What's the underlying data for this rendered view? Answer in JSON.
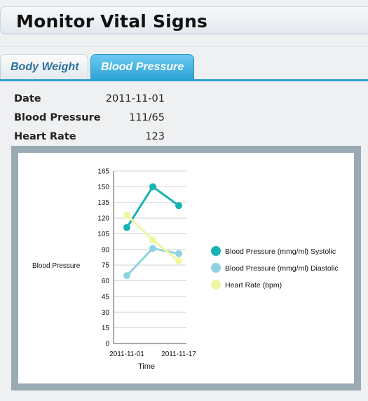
{
  "header": {
    "title": "Monitor Vital Signs"
  },
  "tabs": [
    {
      "label": "Body Weight",
      "active": false
    },
    {
      "label": "Blood Pressure",
      "active": true
    }
  ],
  "info": {
    "date_label": "Date",
    "date_value": "2011-11-01",
    "bp_label": "Blood Pressure",
    "bp_value": "111/65",
    "hr_label": "Heart Rate",
    "hr_value": "123"
  },
  "colors": {
    "systolic": "#16b3b3",
    "diastolic": "#8fd3e3",
    "heart_rate": "#eef7a0",
    "accent": "#2ea4d6"
  },
  "chart_data": {
    "type": "line",
    "xlabel": "Time",
    "ylabel": "Blood Pressure",
    "ylim": [
      0,
      165
    ],
    "yticks": [
      0,
      15,
      30,
      45,
      60,
      75,
      90,
      105,
      120,
      135,
      150,
      165
    ],
    "x_tick_labels": [
      "2011-11-01",
      "2011-11-17"
    ],
    "x": [
      "2011-11-01",
      "2011-11-09",
      "2011-11-17"
    ],
    "grid": true,
    "legend_position": "right",
    "series": [
      {
        "name": "Blood Pressure (mmg/ml) Systolic",
        "values": [
          111,
          150,
          132
        ]
      },
      {
        "name": "Blood Pressure (mmg/ml) Diastolic",
        "values": [
          65,
          91,
          86
        ]
      },
      {
        "name": "Heart Rate (bpm)",
        "values": [
          123,
          99,
          79
        ]
      }
    ]
  }
}
